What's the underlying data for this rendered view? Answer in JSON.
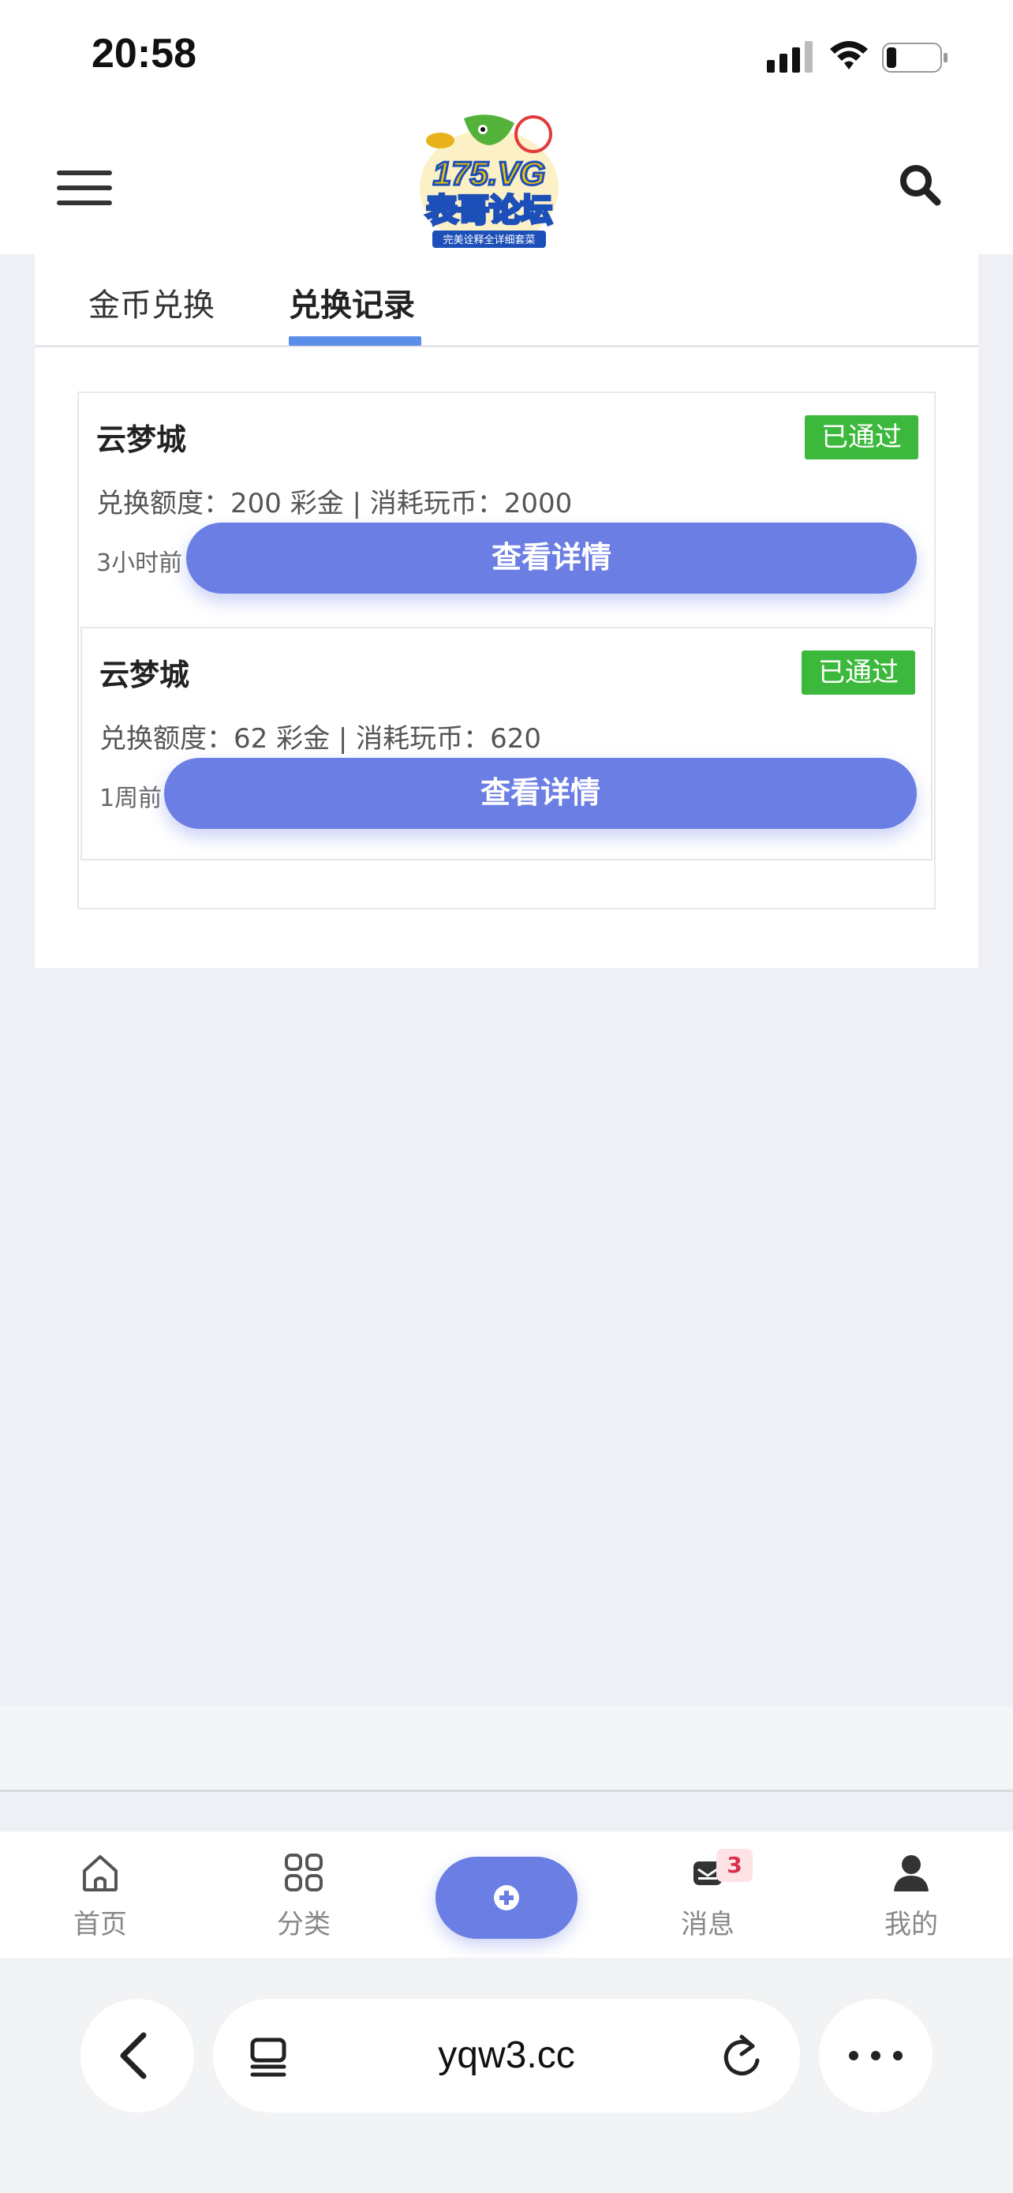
{
  "status_bar": {
    "time": "20:58"
  },
  "header": {
    "logo_alt": "175.VG 表哥论坛",
    "logo_line1": "175.VG",
    "logo_line2": "表哥论坛",
    "logo_tagline": "完美诠释全详细套菜"
  },
  "tabs": [
    {
      "label": "金币兑换",
      "active": false
    },
    {
      "label": "兑换记录",
      "active": true
    }
  ],
  "records": [
    {
      "name": "云梦城",
      "status": "已通过",
      "detail": "兑换额度：200 彩金 | 消耗玩币：2000",
      "time": "3小时前",
      "button": "查看详情"
    },
    {
      "name": "云梦城",
      "status": "已通过",
      "detail": "兑换额度：62 彩金 | 消耗玩币：620",
      "time": "1周前",
      "button": "查看详情"
    }
  ],
  "bottom_nav": {
    "home": "首页",
    "category": "分类",
    "messages": "消息",
    "messages_badge": "3",
    "mine": "我的"
  },
  "browser": {
    "url": "yqw3.cc"
  },
  "colors": {
    "accent": "#6b7ee3",
    "tab_underline": "#5b8ee8",
    "status_ok": "#3cb93c",
    "badge_red": "#d9304d"
  }
}
